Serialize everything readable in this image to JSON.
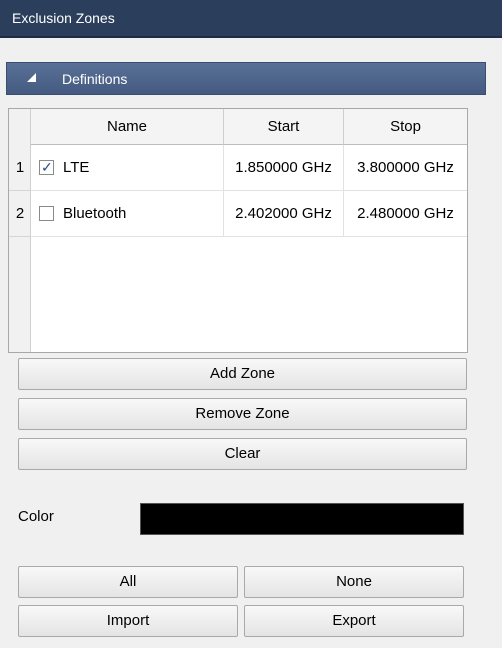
{
  "window": {
    "title": "Exclusion Zones"
  },
  "section": {
    "label": "Definitions"
  },
  "table": {
    "columns": [
      "Name",
      "Start",
      "Stop"
    ],
    "rows": [
      {
        "index": "1",
        "checked": true,
        "name": "LTE",
        "start": "1.850000 GHz",
        "stop": "3.800000 GHz"
      },
      {
        "index": "2",
        "checked": false,
        "name": "Bluetooth",
        "start": "2.402000 GHz",
        "stop": "2.480000 GHz"
      }
    ]
  },
  "buttons": {
    "add_zone": "Add Zone",
    "remove_zone": "Remove Zone",
    "clear": "Clear",
    "all": "All",
    "none": "None",
    "import": "Import",
    "export": "Export"
  },
  "color": {
    "label": "Color",
    "value": "#000000"
  }
}
